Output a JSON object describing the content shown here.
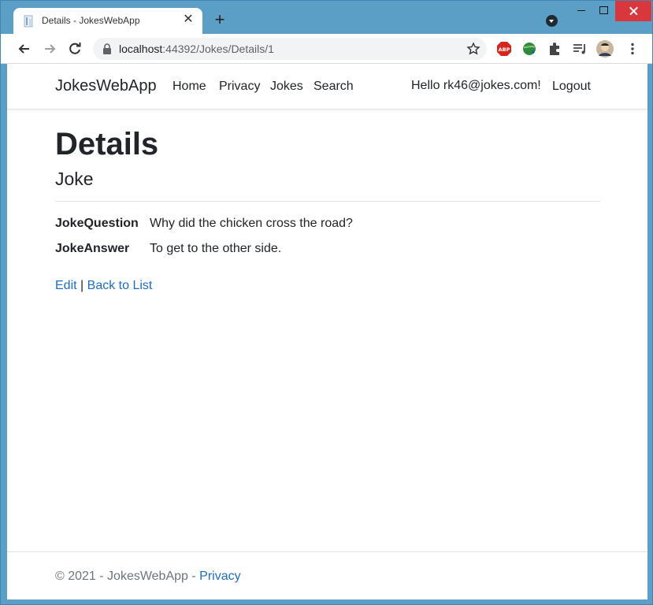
{
  "browser": {
    "tab_title": "Details - JokesWebApp",
    "url_host": "localhost",
    "url_rest": ":44392/Jokes/Details/1",
    "ext_abp_label": "ABP"
  },
  "navbar": {
    "brand": "JokesWebApp",
    "links": [
      "Home",
      "Privacy",
      "Jokes",
      "Search"
    ],
    "greeting": "Hello rk46@jokes.com!",
    "logout": "Logout"
  },
  "main": {
    "title": "Details",
    "subtitle": "Joke",
    "fields": [
      {
        "label": "JokeQuestion",
        "value": "Why did the chicken cross the road?"
      },
      {
        "label": "JokeAnswer",
        "value": "To get to the other side."
      }
    ],
    "edit_link": "Edit",
    "separator": "|",
    "back_link": "Back to List"
  },
  "footer": {
    "text": "© 2021 - JokesWebApp - ",
    "privacy_link": "Privacy"
  },
  "colors": {
    "link": "#1b6ec2",
    "titlebar": "#5b9fc6",
    "close_button": "#d9363e"
  }
}
